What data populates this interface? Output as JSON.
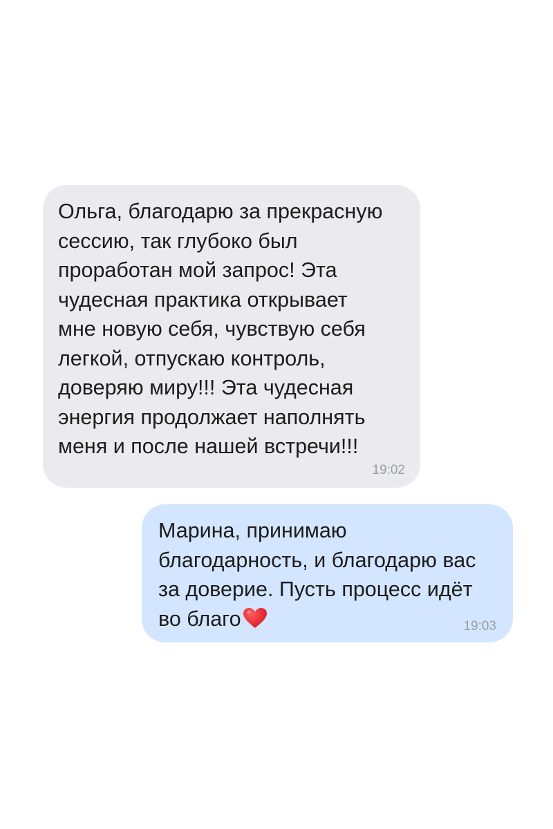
{
  "messages": [
    {
      "direction": "incoming",
      "lines": [
        "Ольга, благодарю за прекрасную",
        "сессию, так глубоко был",
        "проработан мой запрос! Эта",
        "чудесная практика открывает",
        "мне новую себя, чувствую себя",
        "легкой, отпускаю контроль,",
        "доверяю миру!!! Эта чудесная",
        "энергия продолжает наполнять",
        "меня и после нашей встречи!!!"
      ],
      "time": "19:02"
    },
    {
      "direction": "outgoing",
      "lines": [
        "Марина, принимаю",
        "благодарность, и благодарю вас",
        "за доверие. Пусть процесс идёт",
        "во благо"
      ],
      "emoji": "heart-emoji",
      "time": "19:03"
    }
  ],
  "colors": {
    "incoming_bubble": "#ebebef",
    "outgoing_bubble": "#d4e6ff",
    "heart": "#e0202a",
    "timestamp": "#9b9ea6"
  }
}
